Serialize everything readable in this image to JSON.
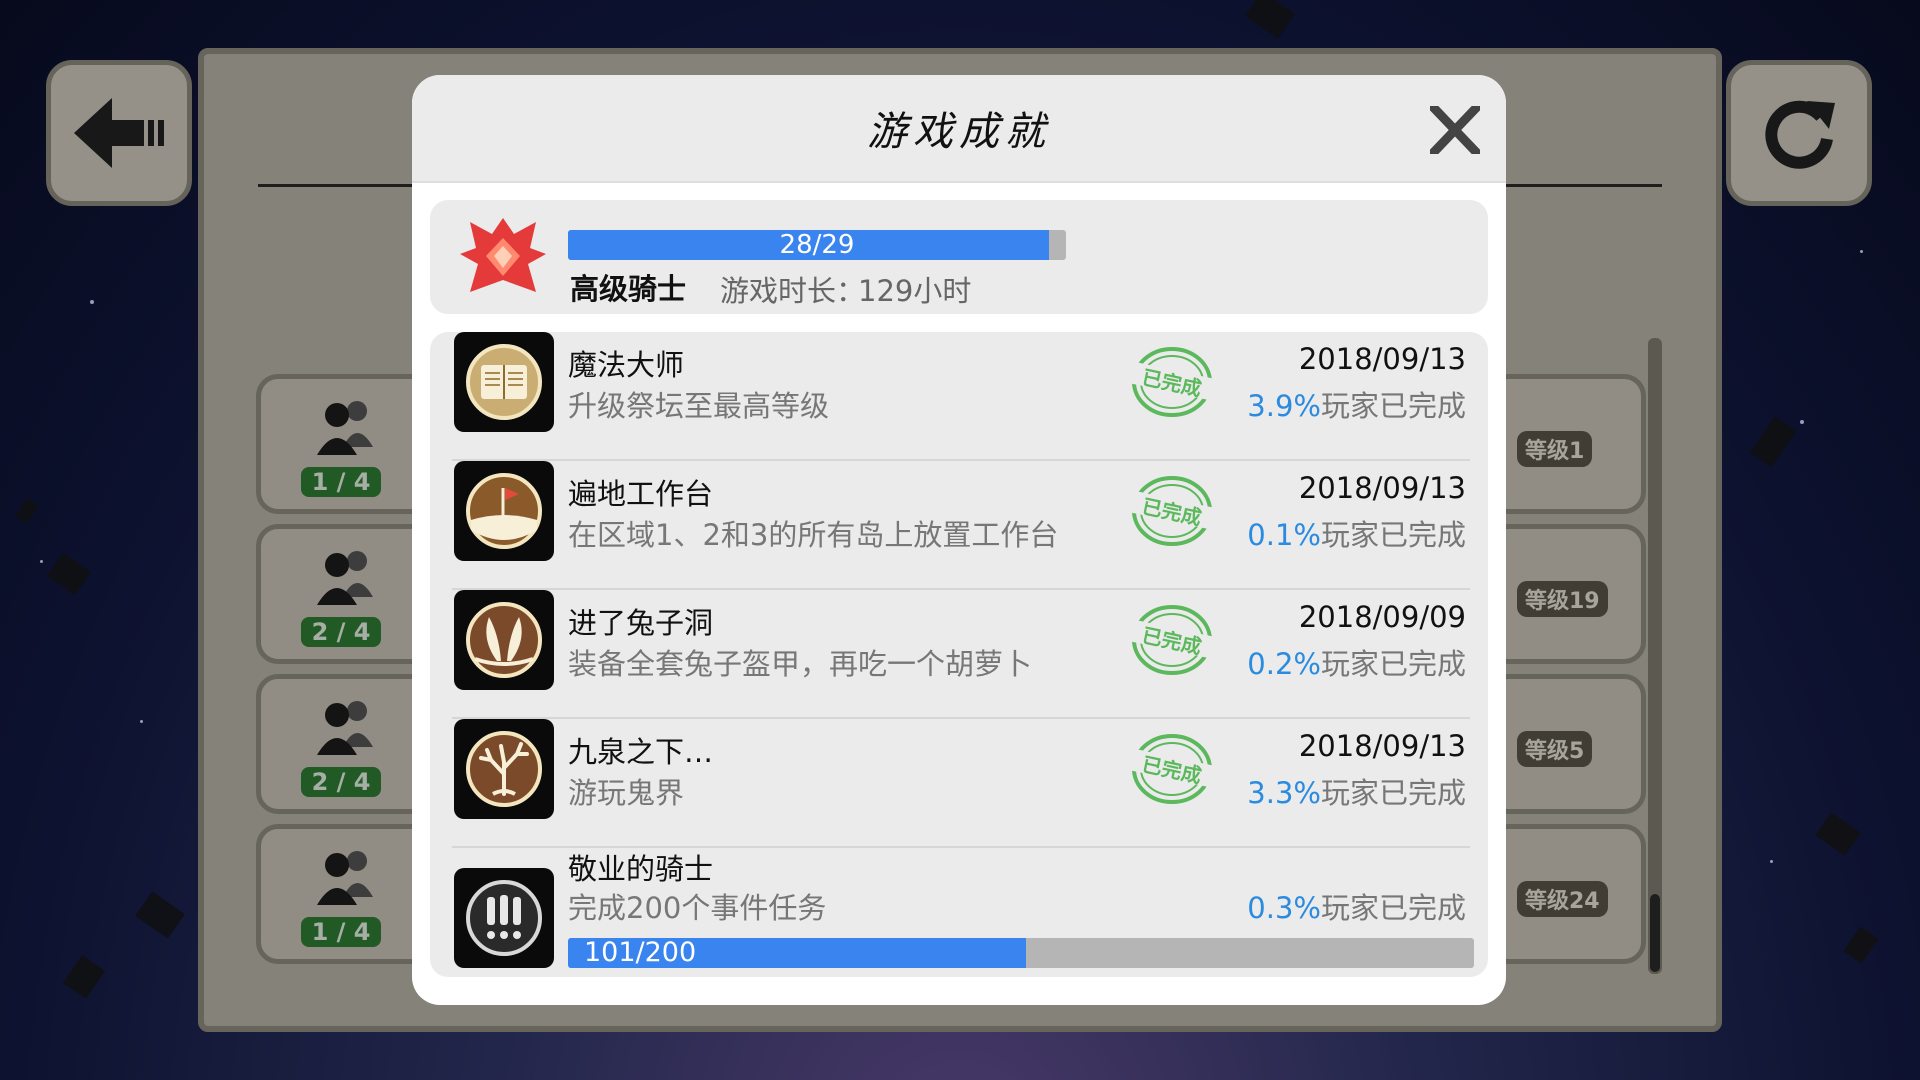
{
  "background": {
    "left_cards": [
      {
        "count": "1 / 4"
      },
      {
        "count": "2 / 4"
      },
      {
        "count": "2 / 4"
      },
      {
        "count": "1 / 4"
      }
    ],
    "right_cards": [
      {
        "level": "等级1"
      },
      {
        "level": "等级19"
      },
      {
        "level": "等级5"
      },
      {
        "level": "等级24"
      }
    ]
  },
  "modal": {
    "title": "游戏成就",
    "close_icon": "close-icon"
  },
  "summary": {
    "progress_text": "28/29",
    "progress_fraction": 0.9655,
    "rank": "高级骑士",
    "playtime_label": "游戏时长：",
    "playtime_value": "129小时"
  },
  "achievements": [
    {
      "name": "魔法大师",
      "desc": "升级祭坛至最高等级",
      "icon": "book-icon",
      "completed": true,
      "stamp": "已完成",
      "date": "2018/09/13",
      "pct": "3.9%",
      "rate_suffix": "玩家已完成"
    },
    {
      "name": "遍地工作台",
      "desc": "在区域1、2和3的所有岛上放置工作台",
      "icon": "flag-icon",
      "completed": true,
      "stamp": "已完成",
      "date": "2018/09/13",
      "pct": "0.1%",
      "rate_suffix": "玩家已完成"
    },
    {
      "name": "进了兔子洞",
      "desc": "装备全套兔子盔甲，再吃一个胡萝卜",
      "icon": "bunny-ears-icon",
      "completed": true,
      "stamp": "已完成",
      "date": "2018/09/09",
      "pct": "0.2%",
      "rate_suffix": "玩家已完成"
    },
    {
      "name": "九泉之下…",
      "desc": "游玩鬼界",
      "icon": "dead-tree-icon",
      "completed": true,
      "stamp": "已完成",
      "date": "2018/09/13",
      "pct": "3.3%",
      "rate_suffix": "玩家已完成"
    },
    {
      "name": "敬业的骑士",
      "desc": "完成200个事件任务",
      "icon": "exclamation-icon",
      "completed": false,
      "pct": "0.3%",
      "rate_suffix": "玩家已完成",
      "progress_text": "101/200",
      "progress_fraction": 0.505
    }
  ]
}
